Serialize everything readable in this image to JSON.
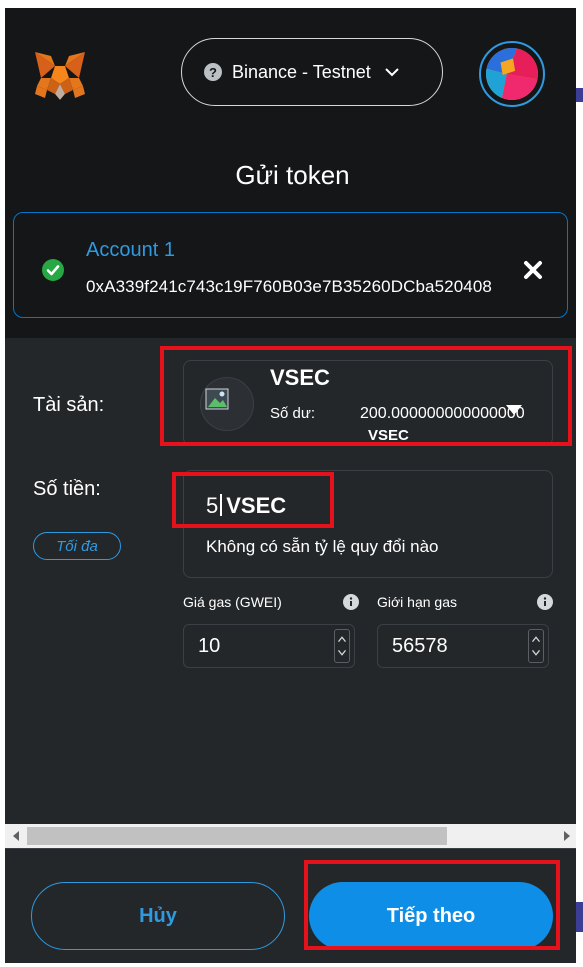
{
  "header": {
    "network": {
      "label": "Binance - Testnet",
      "help_glyph": "?"
    }
  },
  "page": {
    "title": "Gửi token"
  },
  "account": {
    "name": "Account 1",
    "address": "0xA339f241c743c19F760B03e7B35260DCba520408"
  },
  "asset": {
    "label": "Tài sản:",
    "symbol": "VSEC",
    "balance_label": "Số dư:",
    "balance_value": "200.000000000000000",
    "balance_unit": "VSEC"
  },
  "amount": {
    "label": "Số tiền:",
    "max_label": "Tối đa",
    "value": "5",
    "unit": "VSEC",
    "rate_text": "Không có sẵn tỷ lệ quy đổi nào"
  },
  "gas": {
    "price_label": "Giá gas (GWEI)",
    "price_value": "10",
    "limit_label": "Giới hạn gas",
    "limit_value": "56578"
  },
  "footer": {
    "cancel_label": "Hủy",
    "next_label": "Tiếp theo"
  },
  "colors": {
    "accent": "#2f9ae0",
    "primary_button": "#0f8ee8",
    "background_dark": "#141618",
    "background_panel": "#24272a",
    "highlight_red": "#e5121c",
    "success_green": "#28a745"
  }
}
